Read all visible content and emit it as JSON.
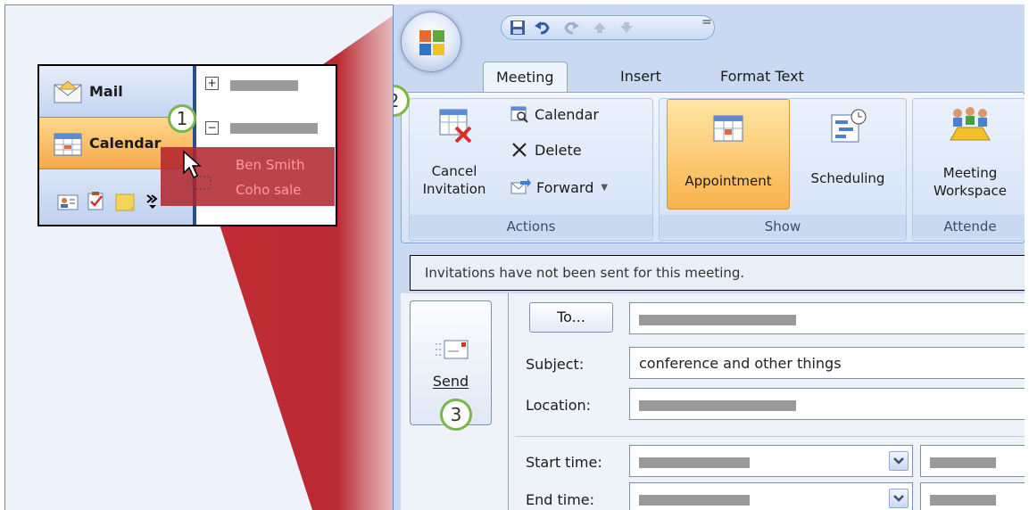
{
  "navigation_pane": {
    "mail_label": "Mail",
    "calendar_label": "Calendar",
    "appointment_name": "Ben Smith",
    "appointment_subject": "Coho sale",
    "tree_expand_top": "+",
    "tree_expand_bottom": "−"
  },
  "callouts": {
    "one": "1",
    "two": "2",
    "three": "3"
  },
  "ribbon": {
    "tabs": {
      "meeting": "Meeting",
      "insert": "Insert",
      "format_text": "Format Text"
    },
    "qat_more": "=",
    "actions": {
      "cancel_invitation_line1": "Cancel",
      "cancel_invitation_line2": "Invitation",
      "calendar": "Calendar",
      "delete": "Delete",
      "forward": "Forward",
      "group_label": "Actions"
    },
    "show": {
      "appointment": "Appointment",
      "scheduling": "Scheduling",
      "group_label": "Show"
    },
    "attendees": {
      "meeting_workspace_line1": "Meeting",
      "meeting_workspace_line2": "Workspace",
      "group_label": "Attende"
    }
  },
  "infobar": {
    "message": "Invitations have not been sent for this meeting."
  },
  "form": {
    "send_label": "Send",
    "to_button": "To...",
    "subject_label": "Subject:",
    "subject_value": "conference and other things",
    "location_label": "Location:",
    "start_time_label": "Start time:",
    "end_time_label": "End time:"
  },
  "colors": {
    "beam": "#c0232b",
    "callout_border": "#7ab648",
    "calendar_highlight": "#f6a84a",
    "appointment_button": "#f9b24c"
  }
}
